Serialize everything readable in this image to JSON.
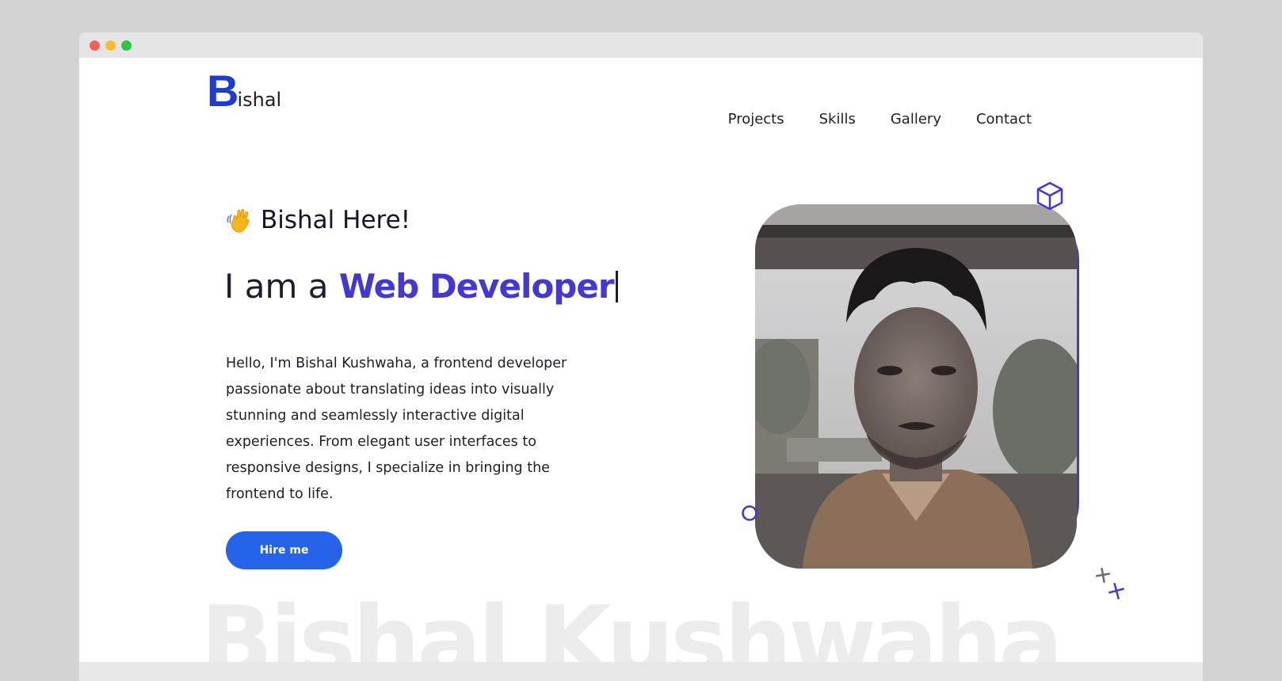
{
  "logo": {
    "initial": "B",
    "rest": "ishal"
  },
  "nav": {
    "items": [
      {
        "label": "Projects"
      },
      {
        "label": "Skills"
      },
      {
        "label": "Gallery"
      },
      {
        "label": "Contact"
      }
    ]
  },
  "hero": {
    "greeting": "Bishal Here!",
    "headline_prefix": "I am a ",
    "headline_role": "Web Developer",
    "bio": "Hello, I'm Bishal Kushwaha, a frontend developer passionate about translating ideas into visually stunning and seamlessly interactive digital experiences. From elegant user interfaces to responsive designs, I specialize in bringing the frontend to life.",
    "cta_label": "Hire me",
    "background_name": "Bishal Kushwaha"
  },
  "colors": {
    "accent": "#4338d6",
    "button": "#2563eb",
    "logo": "#1f3bd1"
  },
  "icons": [
    "wave-hand-icon",
    "cube-icon",
    "circle-decoration",
    "cross-decoration"
  ]
}
